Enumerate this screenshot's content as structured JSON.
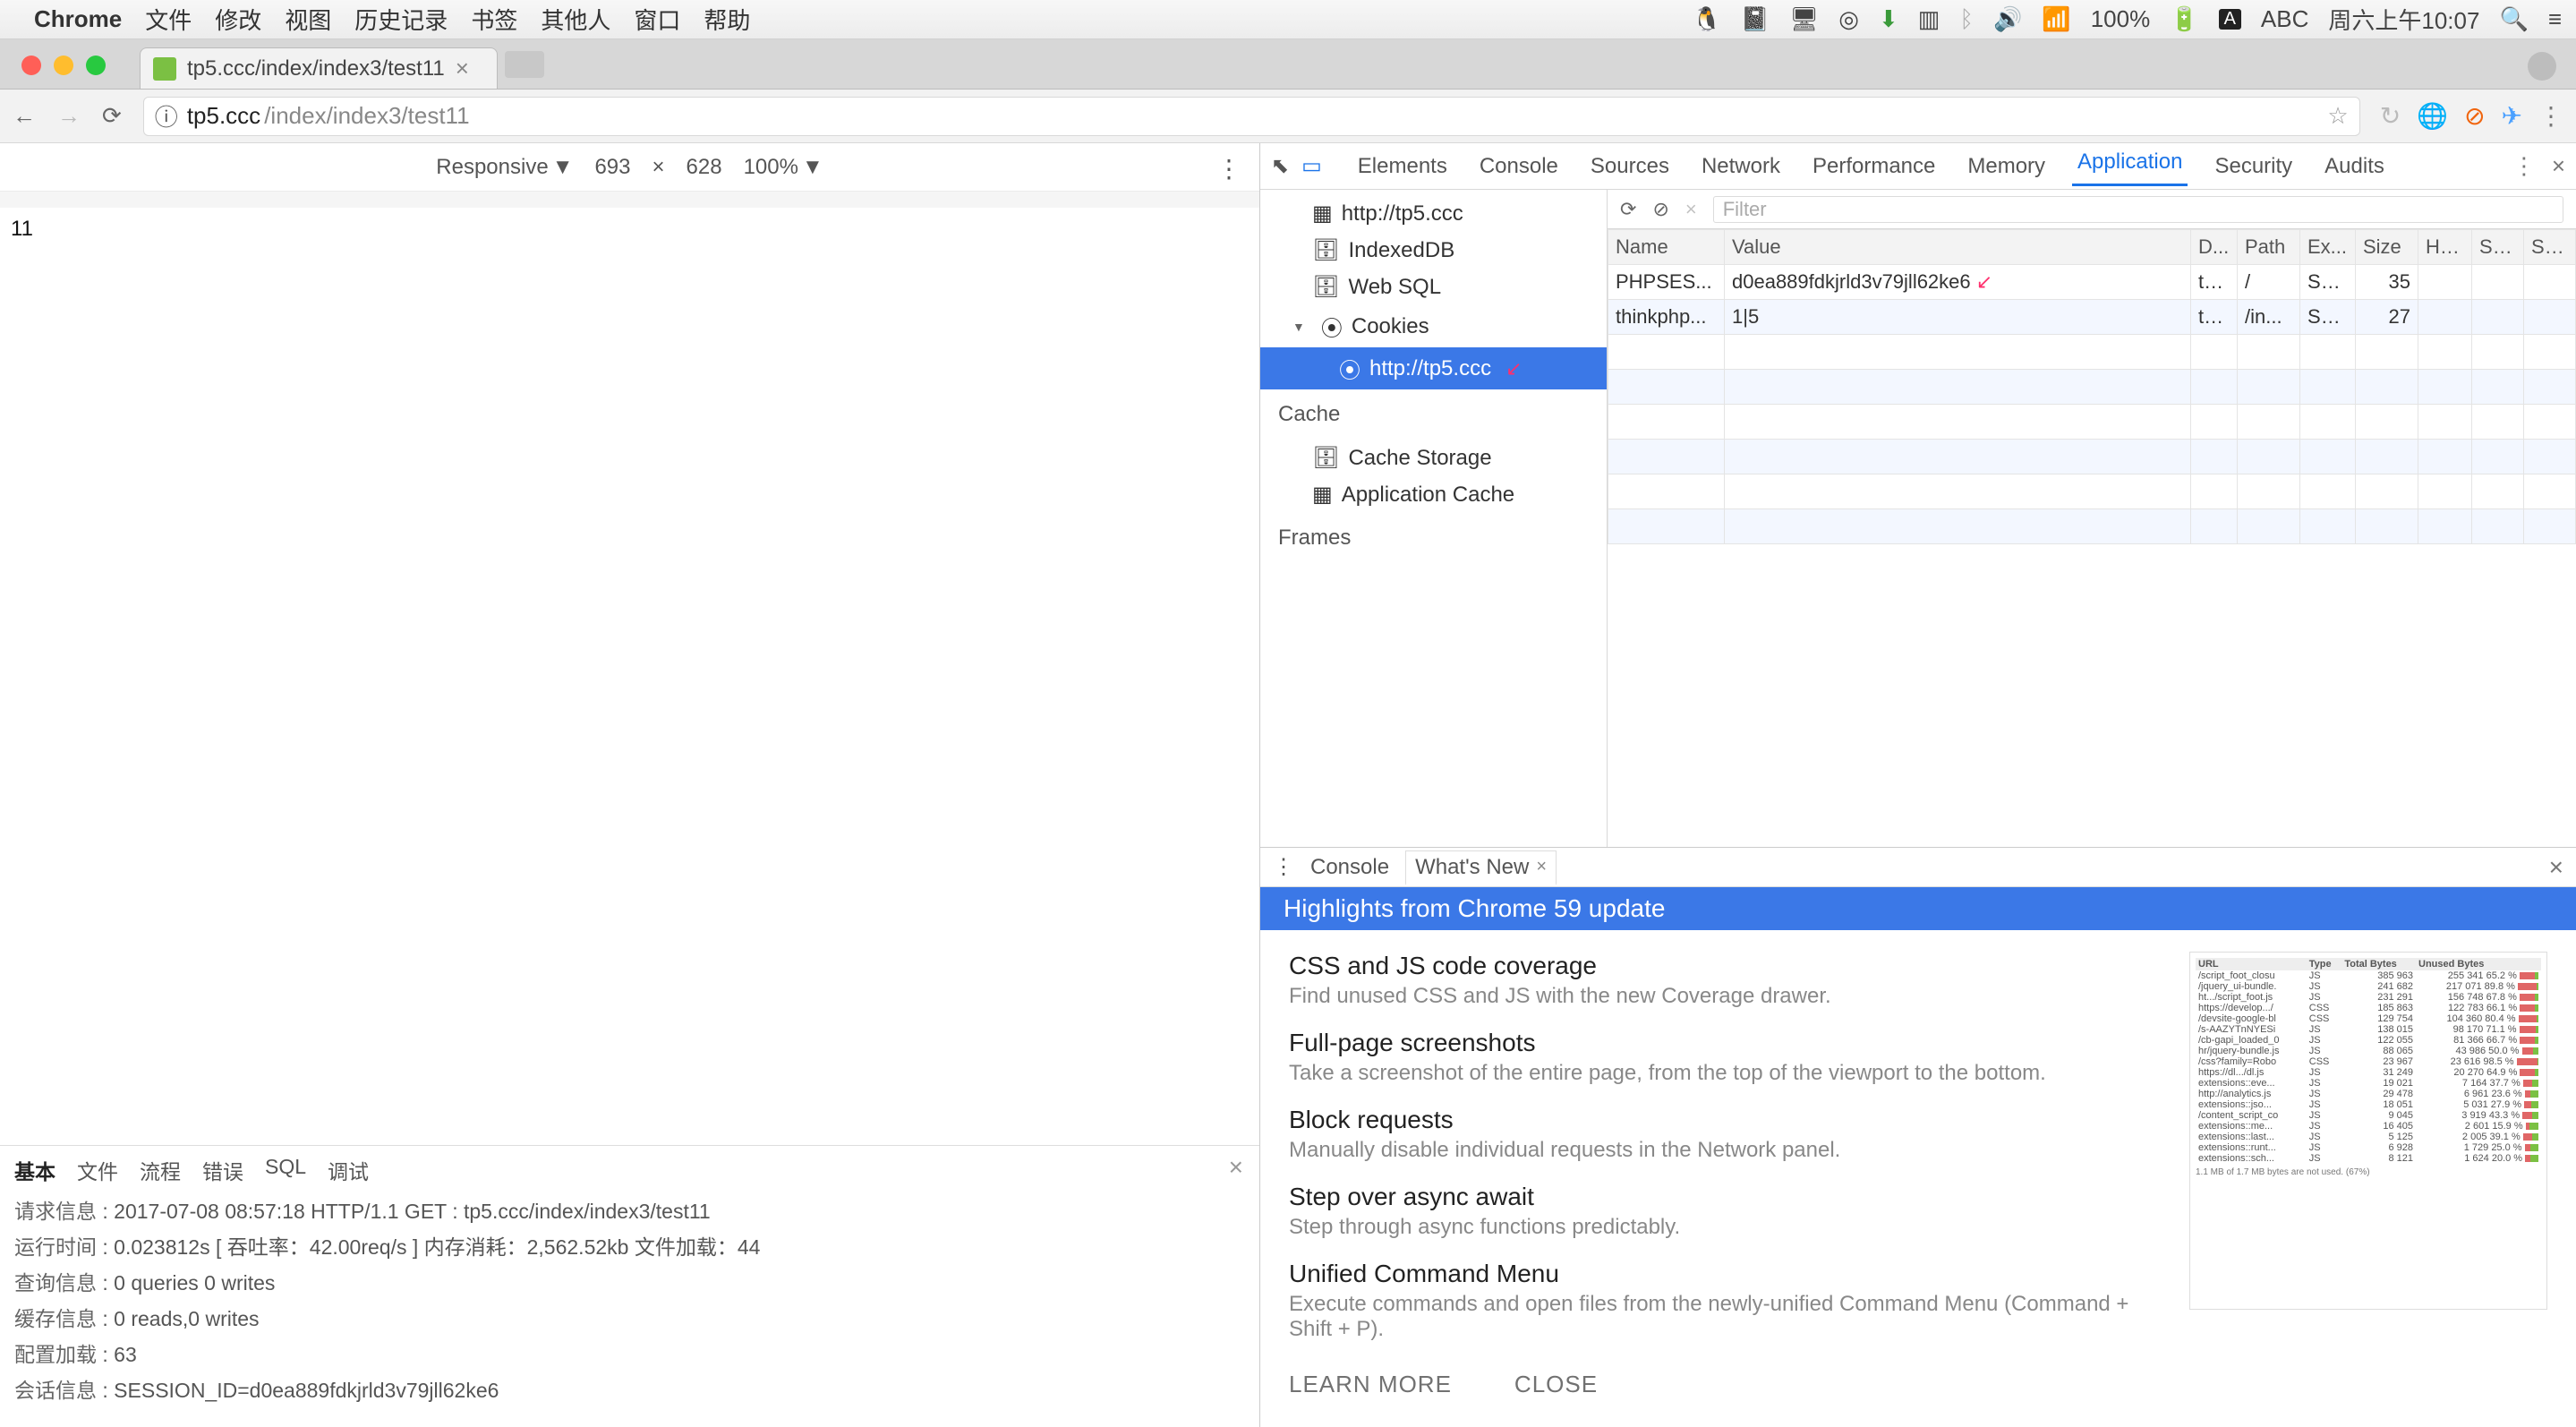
{
  "menubar": {
    "apple": "",
    "app": "Chrome",
    "items": [
      "文件",
      "修改",
      "视图",
      "历史记录",
      "书签",
      "其他人",
      "窗口",
      "帮助"
    ],
    "right": {
      "battery": "100%",
      "ime": "ABC",
      "clock": "周六上午10:07"
    }
  },
  "tab": {
    "title": "tp5.ccc/index/index3/test11"
  },
  "address": {
    "url_host": "tp5.ccc",
    "url_path": "/index/index3/test11",
    "info_icon": "ⓘ"
  },
  "device_toolbar": {
    "mode": "Responsive",
    "width": "693",
    "sep": "×",
    "height": "628",
    "zoom": "100%"
  },
  "page_content": {
    "body": "11"
  },
  "tp_debug": {
    "tabs": [
      "基本",
      "文件",
      "流程",
      "错误",
      "SQL",
      "调试"
    ],
    "rows": [
      [
        "请求信息",
        "2017-07-08 08:57:18 HTTP/1.1 GET : tp5.ccc/index/index3/test11"
      ],
      [
        "运行时间",
        "0.023812s [ 吞吐率：42.00req/s ] 内存消耗：2,562.52kb 文件加载：44"
      ],
      [
        "查询信息",
        "0 queries 0 writes"
      ],
      [
        "缓存信息",
        "0 reads,0 writes"
      ],
      [
        "配置加载",
        "63"
      ],
      [
        "会话信息",
        "SESSION_ID=d0ea889fdkjrld3v79jll62ke6"
      ]
    ]
  },
  "devtools": {
    "tabs": [
      "Elements",
      "Console",
      "Sources",
      "Network",
      "Performance",
      "Memory",
      "Application",
      "Security",
      "Audits"
    ],
    "active_tab": "Application",
    "sidebar": {
      "app_item": "http://tp5.ccc",
      "storage": {
        "indexeddb": "IndexedDB",
        "websql": "Web SQL",
        "cookies_label": "Cookies",
        "cookies_origin": "http://tp5.ccc"
      },
      "cache_header": "Cache",
      "cache": {
        "storage": "Cache Storage",
        "appcache": "Application Cache"
      },
      "frames_header": "Frames"
    },
    "cookie_toolbar": {
      "filter_placeholder": "Filter"
    },
    "cookie_table": {
      "headers": [
        "Name",
        "Value",
        "D...",
        "Path",
        "Ex...",
        "Size",
        "HT...",
        "Se...",
        "Sa..."
      ],
      "rows": [
        {
          "name": "PHPSES...",
          "value": "d0ea889fdkjrld3v79jll62ke6",
          "domain": "tp...",
          "path": "/",
          "expires": "Se...",
          "size": "35",
          "http": "",
          "secure": "",
          "same": ""
        },
        {
          "name": "thinkphp...",
          "value": "1|5",
          "domain": "tp...",
          "path": "/in...",
          "expires": "Se...",
          "size": "27",
          "http": "",
          "secure": "",
          "same": ""
        }
      ]
    }
  },
  "drawer": {
    "tabs": {
      "console": "Console",
      "whatsnew": "What's New"
    },
    "banner": "Highlights from Chrome 59 update",
    "items": [
      {
        "title": "CSS and JS code coverage",
        "desc": "Find unused CSS and JS with the new Coverage drawer."
      },
      {
        "title": "Full-page screenshots",
        "desc": "Take a screenshot of the entire page, from the top of the viewport to the bottom."
      },
      {
        "title": "Block requests",
        "desc": "Manually disable individual requests in the Network panel."
      },
      {
        "title": "Step over async await",
        "desc": "Step through async functions predictably."
      },
      {
        "title": "Unified Command Menu",
        "desc": "Execute commands and open files from the newly-unified Command Menu (Command + Shift + P)."
      }
    ],
    "actions": {
      "learn": "LEARN MORE",
      "close": "CLOSE"
    },
    "preview": {
      "headers": [
        "URL",
        "Type",
        "Total Bytes",
        "Unused Bytes"
      ],
      "rows": [
        [
          "/script_foot_closu",
          "JS",
          "385 963",
          "255 341 65.2 %",
          70
        ],
        [
          "/jquery_ui-bundle.",
          "JS",
          "241 682",
          "217 071 89.8 %",
          85
        ],
        [
          "ht.../script_foot.js",
          "JS",
          "231 291",
          "156 748 67.8 %",
          70
        ],
        [
          "https://develop.../",
          "CSS",
          "185 863",
          "122 783 66.1 %",
          68
        ],
        [
          "/devsite-google-bl",
          "CSS",
          "129 754",
          "104 360 80.4 %",
          80
        ],
        [
          "/s-AAZYTnNYESi",
          "JS",
          "138 015",
          "98 170 71.1 %",
          72
        ],
        [
          "/cb-gapi_loaded_0",
          "JS",
          "122 055",
          "81 366 66.7 %",
          68
        ],
        [
          "hr/jquery-bundle.js",
          "JS",
          "88 065",
          "43 986 50.0 %",
          50
        ],
        [
          "/css?family=Robo",
          "CSS",
          "23 967",
          "23 616 98.5 %",
          95
        ],
        [
          "https://dl.../dl.js",
          "JS",
          "31 249",
          "20 270 64.9 %",
          66
        ],
        [
          "extensions::eve...",
          "JS",
          "19 021",
          "7 164 37.7 %",
          40
        ],
        [
          "http://analytics.js",
          "JS",
          "29 478",
          "6 961 23.6 %",
          25
        ],
        [
          "extensions::jso...",
          "JS",
          "18 051",
          "5 031 27.9 %",
          30
        ],
        [
          "/content_script_co",
          "JS",
          "9 045",
          "3 919 43.3 %",
          45
        ],
        [
          "extensions::me...",
          "JS",
          "16 405",
          "2 601 15.9 %",
          18
        ],
        [
          "extensions::last...",
          "JS",
          "5 125",
          "2 005 39.1 %",
          40
        ],
        [
          "extensions::runt...",
          "JS",
          "6 928",
          "1 729 25.0 %",
          26
        ],
        [
          "extensions::sch...",
          "JS",
          "8 121",
          "1 624 20.0 %",
          22
        ]
      ],
      "footer": "1.1 MB of 1.7 MB bytes are not used. (67%)"
    }
  }
}
